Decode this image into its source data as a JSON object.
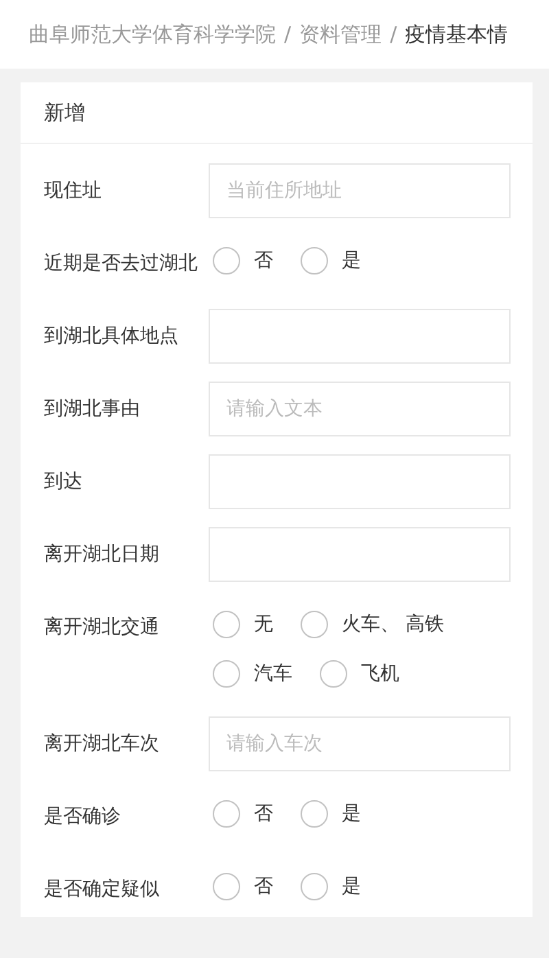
{
  "breadcrumb_separator": "/",
  "breadcrumb": [
    {
      "label": "曲阜师范大学体育科学学院",
      "current": false
    },
    {
      "label": "资料管理",
      "current": false
    },
    {
      "label": "疫情基本情",
      "current": true
    }
  ],
  "card": {
    "title": "新增",
    "fields": [
      {
        "kind": "input",
        "label": "现住址",
        "placeholder": "当前住所地址"
      },
      {
        "kind": "radio",
        "label": "近期是否去过湖北",
        "options": [
          {
            "label": "否",
            "selected": false
          },
          {
            "label": "是",
            "selected": false
          }
        ]
      },
      {
        "kind": "input",
        "label": "到湖北具体地点"
      },
      {
        "kind": "input",
        "label": "到湖北事由",
        "placeholder": "请输入文本"
      },
      {
        "kind": "input",
        "label": "到达"
      },
      {
        "kind": "input",
        "label": "离开湖北日期"
      },
      {
        "kind": "radio",
        "label": "离开湖北交通",
        "options": [
          {
            "label": "无",
            "selected": false
          },
          {
            "label": "火车、 高铁",
            "selected": false
          },
          {
            "label": "汽车",
            "selected": false
          },
          {
            "label": "飞机",
            "selected": false
          }
        ]
      },
      {
        "kind": "input",
        "label": "离开湖北车次",
        "placeholder": "请输入车次"
      },
      {
        "kind": "radio",
        "label": "是否确诊",
        "options": [
          {
            "label": "否",
            "selected": false
          },
          {
            "label": "是",
            "selected": false
          }
        ]
      },
      {
        "kind": "radio",
        "label": "是否确定疑似",
        "options": [
          {
            "label": "否",
            "selected": false
          },
          {
            "label": "是",
            "selected": false
          }
        ]
      }
    ]
  }
}
